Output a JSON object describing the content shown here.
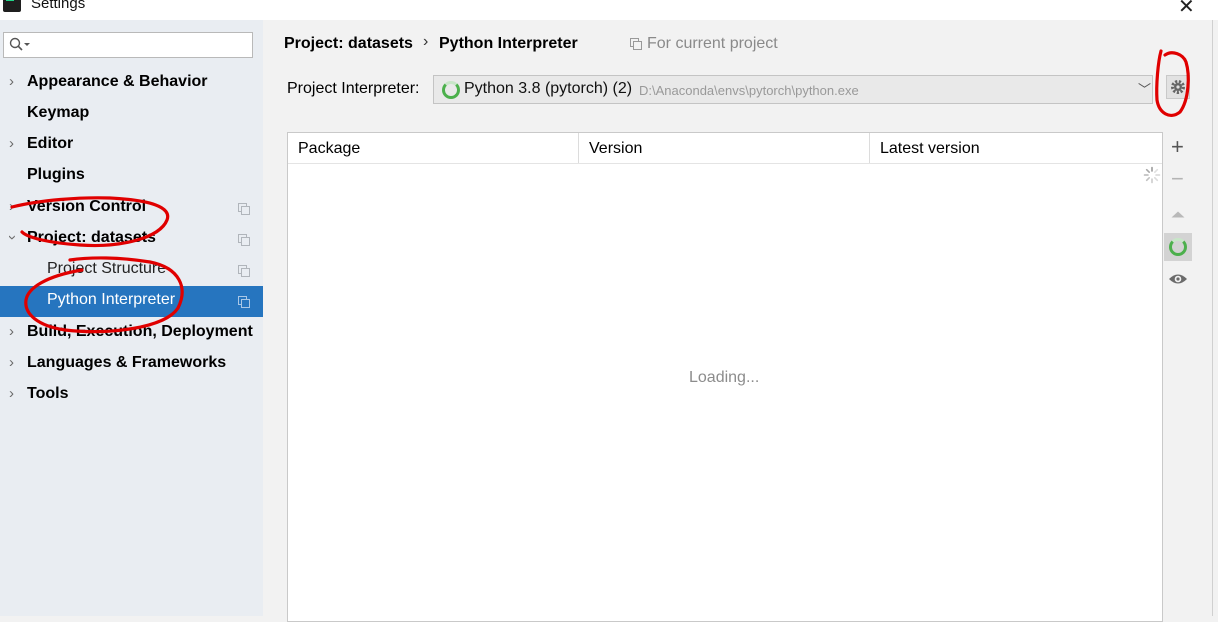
{
  "window": {
    "title": "Settings"
  },
  "search": {
    "placeholder": ""
  },
  "sidebar": {
    "items": [
      {
        "label": "Appearance & Behavior"
      },
      {
        "label": "Keymap"
      },
      {
        "label": "Editor"
      },
      {
        "label": "Plugins"
      },
      {
        "label": "Version Control"
      },
      {
        "label": "Project: datasets"
      },
      {
        "label": "Project Structure"
      },
      {
        "label": "Python Interpreter"
      },
      {
        "label": "Build, Execution, Deployment"
      },
      {
        "label": "Languages & Frameworks"
      },
      {
        "label": "Tools"
      }
    ],
    "selected": "Python Interpreter"
  },
  "breadcrumb": {
    "project": "Project: datasets",
    "page": "Python Interpreter",
    "scope": "For current project"
  },
  "interpreter": {
    "label": "Project Interpreter:",
    "name": "Python 3.8 (pytorch) (2)",
    "path": "D:\\Anaconda\\envs\\pytorch\\python.exe"
  },
  "packages_table": {
    "columns": [
      "Package",
      "Version",
      "Latest version"
    ],
    "rows": [],
    "status": "Loading..."
  },
  "icons": [
    "search-icon",
    "gear-icon",
    "add-icon",
    "remove-icon",
    "upgrade-icon",
    "refresh-icon",
    "eye-icon",
    "copy-icon",
    "spinner-icon"
  ],
  "colors": {
    "selection": "#2675bf",
    "sidebar_bg": "#e9edf2",
    "annotation_red": "#e00000",
    "loading_green": "#4cb04c"
  }
}
